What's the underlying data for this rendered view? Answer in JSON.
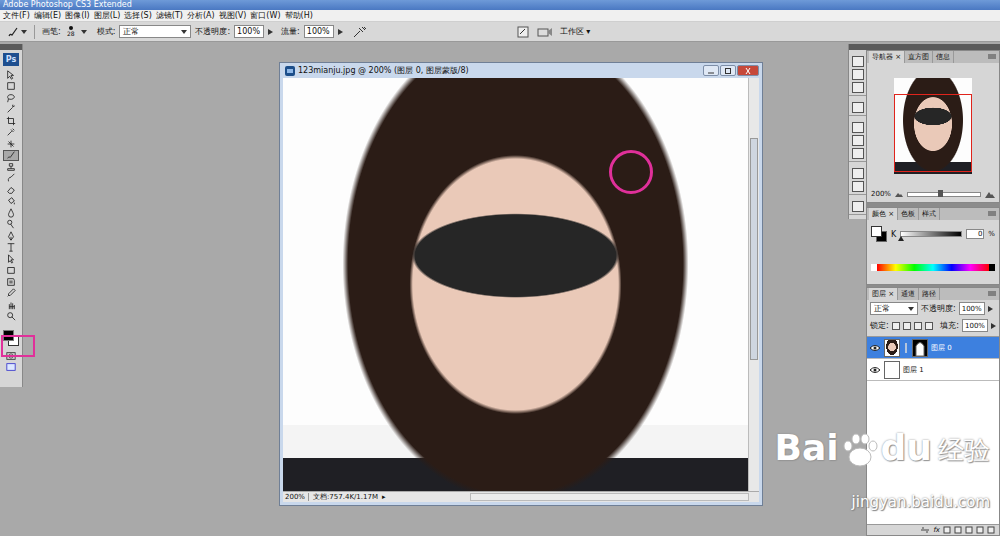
{
  "window": {
    "title": "Adobe Photoshop CS3 Extended"
  },
  "menu": [
    "文件(F)",
    "编辑(E)",
    "图像(I)",
    "图层(L)",
    "选择(S)",
    "滤镜(T)",
    "分析(A)",
    "视图(V)",
    "窗口(W)",
    "帮助(H)"
  ],
  "options_bar": {
    "brush_label": "画笔:",
    "brush_size": "28",
    "mode_label": "模式:",
    "mode": "正常",
    "opacity_label": "不透明度:",
    "opacity": "100%",
    "flow_label": "流量:",
    "flow": "100%",
    "workspace": "工作区 ▾"
  },
  "toolbox": {
    "logo": "Ps",
    "tools": [
      {
        "selected": false
      },
      {
        "selected": false
      },
      {
        "selected": false
      },
      {
        "selected": false
      },
      {
        "selected": false
      },
      {
        "selected": false
      },
      {
        "selected": false
      },
      {
        "selected": true
      },
      {
        "selected": false
      },
      {
        "selected": false
      },
      {
        "selected": false
      },
      {
        "selected": false
      },
      {
        "selected": false
      },
      {
        "selected": false
      },
      {
        "selected": false
      },
      {
        "selected": false
      },
      {
        "selected": false
      },
      {
        "selected": false
      },
      {
        "selected": false
      },
      {
        "selected": false
      },
      {
        "selected": false
      },
      {
        "selected": false
      }
    ]
  },
  "document": {
    "title": "123mianju.jpg @ 200% (图层 0, 图层蒙版/8)",
    "zoom": "200%",
    "info": "文档:757.4K/1.17M",
    "arrow": "▸"
  },
  "navigator": {
    "tabs": [
      {
        "label": "导航器 ×",
        "selected": true
      },
      {
        "label": "直方图",
        "selected": false
      },
      {
        "label": "信息",
        "selected": false
      }
    ],
    "zoom": "200%",
    "level": 0.45
  },
  "color_panel": {
    "tabs": [
      {
        "label": "颜色 ×",
        "selected": true
      },
      {
        "label": "色板",
        "selected": false
      },
      {
        "label": "样式",
        "selected": false
      }
    ],
    "channel": "K",
    "value": "0",
    "unit": "%",
    "level": 0
  },
  "layers_panel": {
    "tabs": [
      {
        "label": "图层 ×",
        "selected": true
      },
      {
        "label": "通道",
        "selected": false
      },
      {
        "label": "路径",
        "selected": false
      }
    ],
    "blend": "正常",
    "opacity_label": "不透明度:",
    "opacity": "100%",
    "lock_label": "锁定:",
    "fill_label": "填充:",
    "fill": "100%",
    "fx": "fx",
    "layers": [
      {
        "name": "图层 0",
        "selected": true,
        "visible": true,
        "has_mask": true
      },
      {
        "name": "图层 1",
        "selected": false,
        "visible": true,
        "has_mask": false
      }
    ]
  },
  "watermark": {
    "brand_a": "Bai",
    "brand_b": "du",
    "product": "经验",
    "url": "jingyan.baidu.com"
  }
}
